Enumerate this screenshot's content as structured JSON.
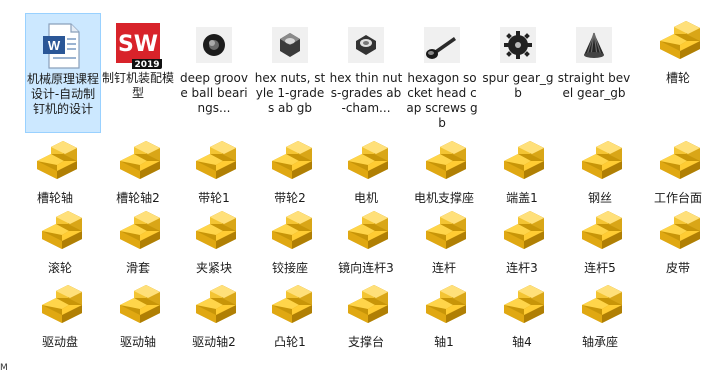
{
  "window": {
    "title": "制钉机装配模型"
  },
  "files": {
    "row1": [
      {
        "name": "机械原理课程设计-自动制钉机的设计",
        "icon": "word-doc-icon",
        "selected": true
      },
      {
        "name": "制钉机装配模型",
        "icon": "solidworks-2019-icon",
        "badge": "SW",
        "badge_sub": "2019"
      },
      {
        "name": "deep groove ball bearings...",
        "icon": "bearing-part-icon"
      },
      {
        "name": "hex nuts, style 1-grades ab gb",
        "icon": "hex-nut-part-icon"
      },
      {
        "name": "hex thin nuts-grades ab-cham...",
        "icon": "thin-nut-part-icon"
      },
      {
        "name": "hexagon socket head cap screws gb",
        "icon": "cap-screw-part-icon"
      },
      {
        "name": "spur gear_gb",
        "icon": "spur-gear-part-icon"
      },
      {
        "name": "straight bevel gear_gb",
        "icon": "bevel-gear-part-icon"
      },
      {
        "name": "槽轮",
        "icon": "yellow-part-icon"
      }
    ],
    "row2": [
      "槽轮轴",
      "槽轮轴2",
      "带轮1",
      "带轮2",
      "电机",
      "电机支撑座",
      "端盖1",
      "钢丝",
      "工作台面"
    ],
    "row3": [
      "滚轮",
      "滑套",
      "夹紧块",
      "铰接座",
      "镜向连杆3",
      "连杆",
      "连杆3",
      "连杆5",
      "皮带"
    ],
    "row4": [
      "驱动盘",
      "驱动轴",
      "驱动轴2",
      "凸轮1",
      "支撑台",
      "轴1",
      "轴4",
      "轴承座"
    ]
  },
  "colors": {
    "selection_bg": "#cce8ff",
    "selection_border": "#99d1ff",
    "part_yellow": "#f2c12e",
    "sw_red": "#d8232a"
  },
  "status": {
    "corner_text": "M"
  }
}
